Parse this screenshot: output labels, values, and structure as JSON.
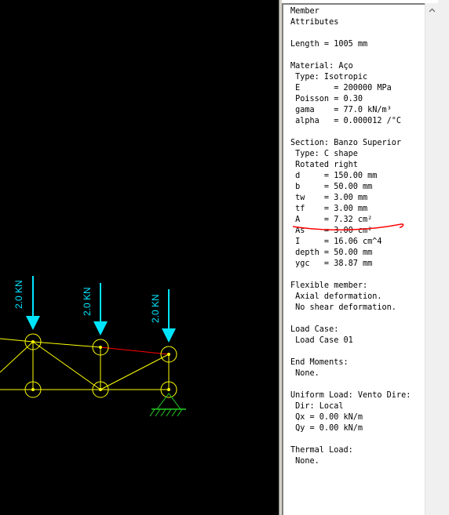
{
  "canvas": {
    "background": "#000000",
    "member_color": "#ffff00",
    "highlighted_member_color": "#ff0000",
    "load_color": "#00e5ff",
    "support_color": "#22cc22",
    "loads": [
      {
        "label": "2.0 KN"
      },
      {
        "label": "2.0 KN"
      },
      {
        "label": "2.0 KN"
      }
    ],
    "nodes_top": [
      "node",
      "node",
      "node"
    ],
    "nodes_bottom": [
      "node",
      "node",
      "node"
    ],
    "support": "pin-support-icon"
  },
  "panel": {
    "annotation_color": "#ff0000",
    "lines": [
      "Member",
      "Attributes",
      "",
      "Length = 1005 mm",
      "",
      "Material: Aço",
      " Type: Isotropic",
      " E       = 200000 MPa",
      " Poisson = 0.30",
      " gama    = 77.0 kN/m³",
      " alpha   = 0.000012 /°C",
      "",
      "Section: Banzo Superior",
      " Type: C shape",
      " Rotated right",
      " d     = 150.00 mm",
      " b     = 50.00 mm",
      " tw    = 3.00 mm",
      " tf    = 3.00 mm",
      " A     = 7.32 cm²",
      " As    = 3.00 cm²",
      " I     = 16.06 cm^4",
      " depth = 50.00 mm",
      " ygc   = 38.87 mm",
      "",
      "Flexible member:",
      " Axial deformation.",
      " No shear deformation.",
      "",
      "Load Case:",
      " Load Case 01",
      "",
      "End Moments:",
      " None.",
      "",
      "Uniform Load: Vento Dire:",
      " Dir: Local",
      " Qx = 0.00 kN/m",
      " Qy = 0.00 kN/m",
      "",
      "Thermal Load:",
      " None."
    ]
  }
}
